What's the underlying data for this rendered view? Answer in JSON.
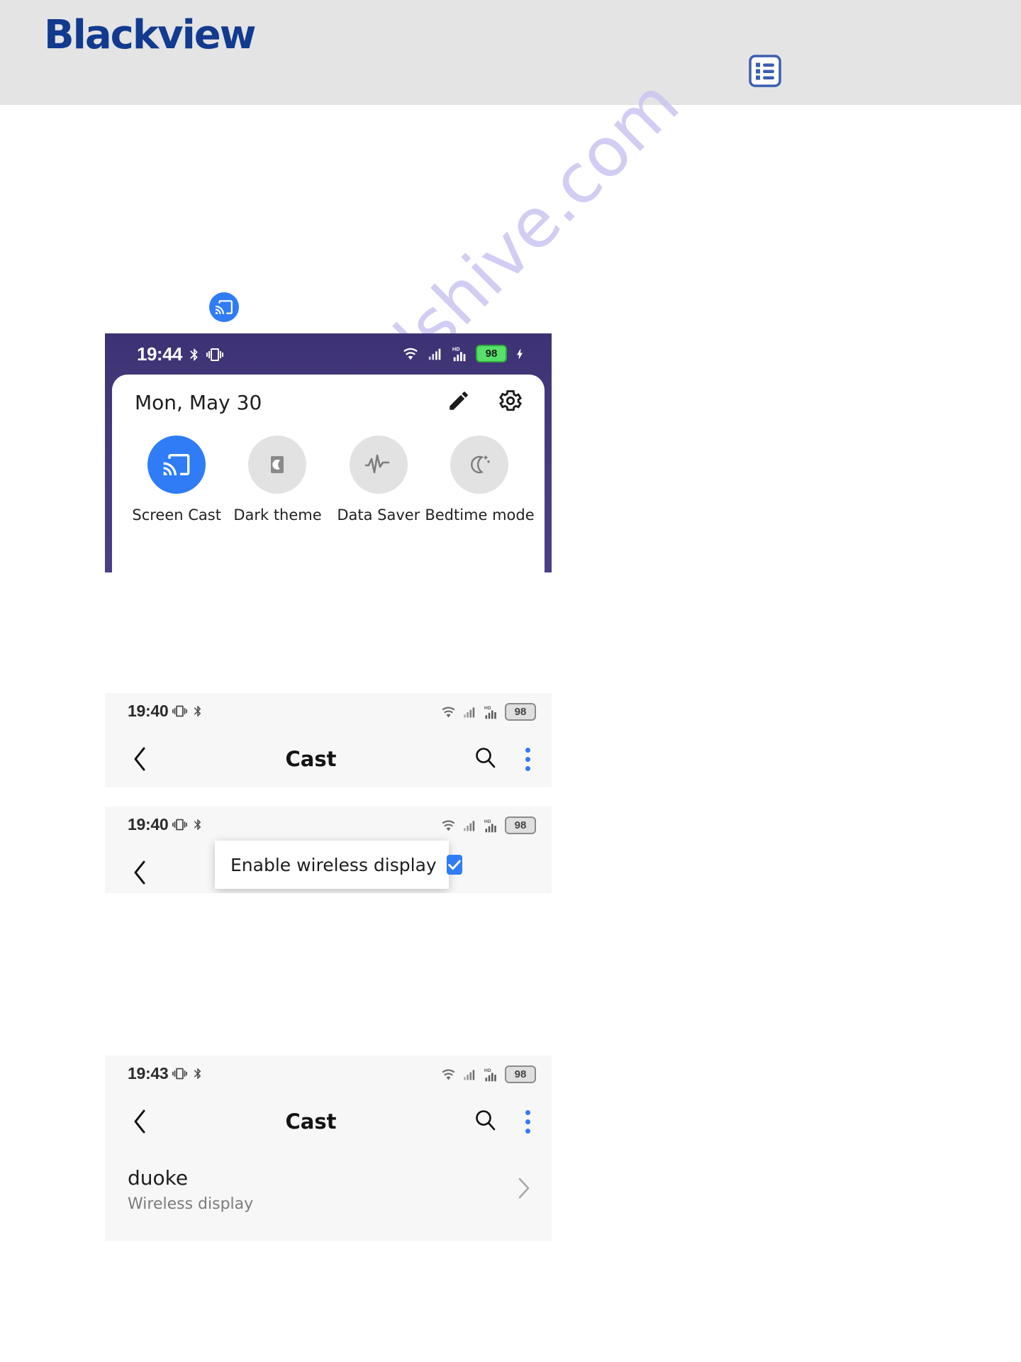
{
  "header": {
    "brand": "Blackview",
    "list_icon": "list-icon"
  },
  "watermark": "manualshive.com",
  "cast_badge_icon": "cast-icon",
  "quick_settings": {
    "statusbar": {
      "time": "19:44",
      "icons_left": [
        "bluetooth-icon",
        "vibrate-icon"
      ],
      "icons_right": [
        "wifi-icon",
        "signal-icon",
        "hd-signal-icon"
      ],
      "battery": "98",
      "charging_icon": "charging-bolt-icon"
    },
    "date": "Mon, May 30",
    "edit_icon": "pencil-icon",
    "settings_icon": "gear-icon",
    "tiles": [
      {
        "label": "Screen Cast",
        "icon": "cast-icon",
        "active": true
      },
      {
        "label": "Dark theme",
        "icon": "moon-icon",
        "active": false
      },
      {
        "label": "Data Saver",
        "icon": "pulse-icon",
        "active": false
      },
      {
        "label": "Bedtime mode",
        "icon": "bedtime-icon",
        "active": false
      }
    ]
  },
  "cast_screen_a": {
    "statusbar": {
      "time": "19:40",
      "icons_left": [
        "vibrate-icon",
        "bluetooth-icon"
      ],
      "icons_right": [
        "wifi-icon",
        "signal-icon",
        "hd-signal-icon"
      ],
      "battery": "98"
    },
    "back_icon": "chevron-left-icon",
    "title": "Cast",
    "search_icon": "search-icon",
    "overflow_icon": "more-vertical-icon"
  },
  "cast_screen_b": {
    "statusbar": {
      "time": "19:40",
      "icons_left": [
        "vibrate-icon",
        "bluetooth-icon"
      ],
      "icons_right": [
        "wifi-icon",
        "signal-icon",
        "hd-signal-icon"
      ],
      "battery": "98"
    },
    "back_icon": "chevron-left-icon",
    "menu_item": "Enable wireless display",
    "menu_checked": true
  },
  "cast_screen_c": {
    "statusbar": {
      "time": "19:43",
      "icons_left": [
        "vibrate-icon",
        "bluetooth-icon"
      ],
      "icons_right": [
        "wifi-icon",
        "signal-icon",
        "hd-signal-icon"
      ],
      "battery": "98"
    },
    "back_icon": "chevron-left-icon",
    "title": "Cast",
    "search_icon": "search-icon",
    "overflow_icon": "more-vertical-icon",
    "device": {
      "name": "duoke",
      "subtitle": "Wireless display",
      "chevron_icon": "chevron-right-icon"
    }
  }
}
